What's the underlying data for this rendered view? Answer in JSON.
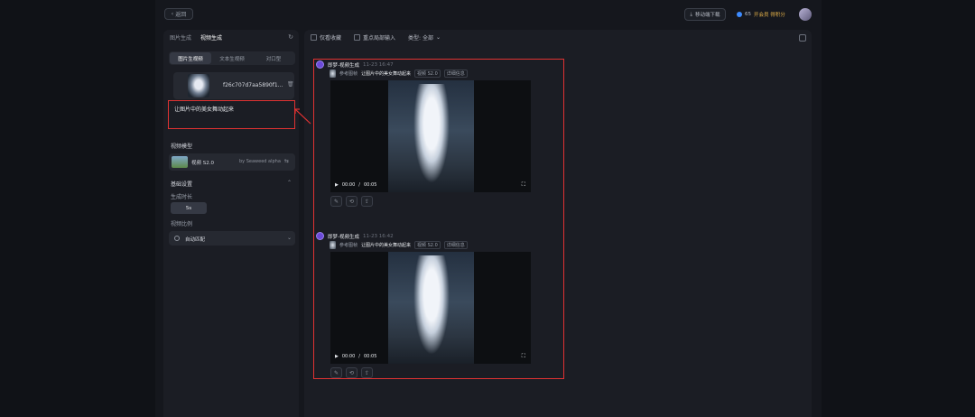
{
  "topbar": {
    "back_label": "返回",
    "download_label": "移动端下载",
    "credits": "65",
    "member_label": "开会员 得积分"
  },
  "left": {
    "tabs": [
      {
        "label": "图片生成"
      },
      {
        "label": "视频生成"
      }
    ],
    "modes": [
      {
        "label": "图片生视频"
      },
      {
        "label": "文本生视频"
      },
      {
        "label": "对口型"
      }
    ],
    "reference_filename": "f26c707d7aa5890f1...",
    "prompt": "让图片中的美女舞动起来",
    "model_section": "视频模型",
    "model_name": "视频 S2.0",
    "model_by": "by Seaweed alpha",
    "basic_section": "基础设置",
    "duration_label": "生成时长",
    "duration_value": "5s",
    "ratio_label": "视频比例",
    "ratio_value": "自动匹配"
  },
  "main": {
    "filters": [
      {
        "label": "仅看收藏"
      },
      {
        "label": "重点局部输入"
      },
      {
        "label": "类型: 全部"
      }
    ],
    "generations": [
      {
        "title": "即梦-视频生成",
        "time": "11-23 16:47",
        "ref_label": "参考图帧",
        "prompt": "让图片中的美女舞动起来",
        "model_tag": "视频 S2.0",
        "detail_tag": "详细信息",
        "current": "00:00",
        "sep": "/",
        "duration": "00:05"
      },
      {
        "title": "即梦-视频生成",
        "time": "11-23 16:42",
        "ref_label": "参考图帧",
        "prompt": "让图片中的美女舞动起来",
        "model_tag": "视频 S2.0",
        "detail_tag": "详细信息",
        "current": "00:00",
        "sep": "/",
        "duration": "00:05"
      }
    ]
  },
  "colors": {
    "highlight": "#e03232",
    "brand": "#6b4ad8",
    "accent": "#3d8bff"
  }
}
